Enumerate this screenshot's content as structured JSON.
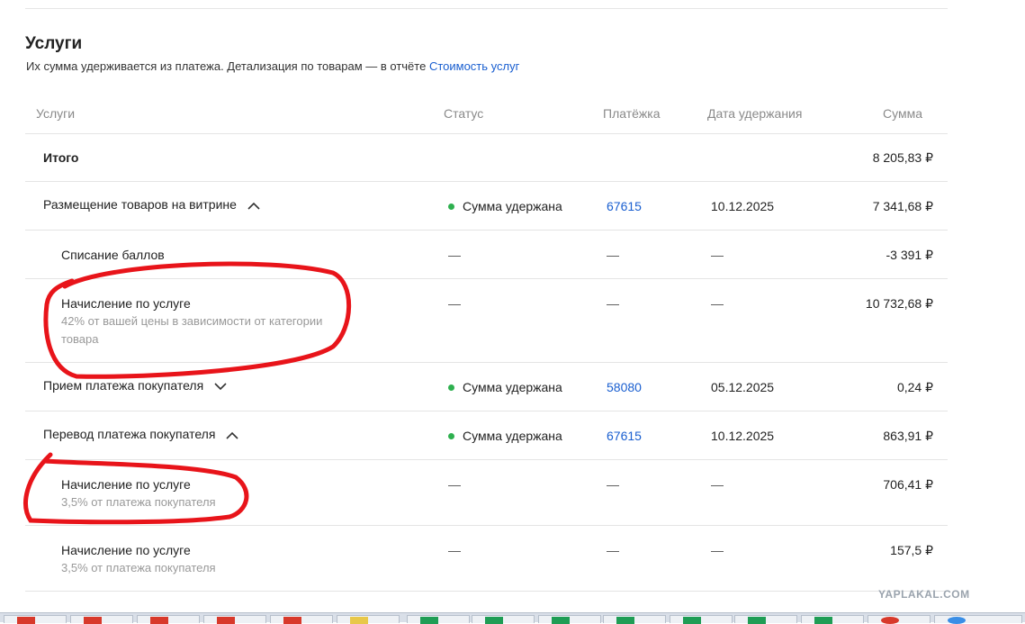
{
  "section": {
    "title": "Услуги",
    "subtitle_text": "Их сумма удерживается из платежа. Детализация по товарам — в отчёте",
    "subtitle_link": "Стоимость услуг"
  },
  "table": {
    "headers": {
      "name": "Услуги",
      "status": "Статус",
      "payment": "Платёжка",
      "date": "Дата удержания",
      "sum": "Сумма"
    },
    "total": {
      "label": "Итого",
      "sum": "8 205,83 ₽"
    },
    "rows": [
      {
        "name": "Размещение товаров на витрине",
        "status": "Сумма удержана",
        "payment": "67615",
        "date": "10.12.2025",
        "sum": "7 341,68 ₽"
      },
      {
        "name": "Списание баллов",
        "status": "—",
        "payment": "—",
        "date": "—",
        "sum": "-3 391 ₽"
      },
      {
        "name": "Начисление по услуге",
        "note": "42% от вашей цены в зависимости от категории",
        "note2": "товара",
        "status": "—",
        "payment": "—",
        "date": "—",
        "sum": "10 732,68 ₽"
      },
      {
        "name": "Прием платежа покупателя",
        "status": "Сумма удержана",
        "payment": "58080",
        "date": "05.12.2025",
        "sum": "0,24 ₽"
      },
      {
        "name": "Перевод платежа покупателя",
        "status": "Сумма удержана",
        "payment": "67615",
        "date": "10.12.2025",
        "sum": "863,91 ₽"
      },
      {
        "name": "Начисление по услуге",
        "note": "3,5% от платежа покупателя",
        "status": "—",
        "payment": "—",
        "date": "—",
        "sum": "706,41 ₽"
      },
      {
        "name": "Начисление по услуге",
        "note": "3,5% от платежа покупателя",
        "status": "—",
        "payment": "—",
        "date": "—",
        "sum": "157,5 ₽"
      }
    ]
  },
  "watermark": "YAPLAKAL.COM",
  "colors": {
    "link": "#1a5fd0",
    "status_dot": "#2eb04f",
    "annotation": "#e8141a"
  }
}
